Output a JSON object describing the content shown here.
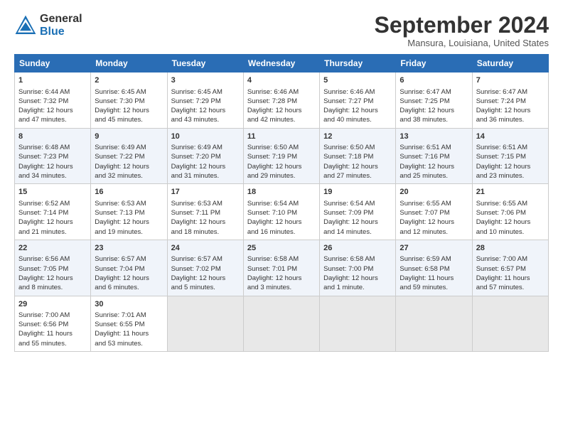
{
  "header": {
    "logo_general": "General",
    "logo_blue": "Blue",
    "month_title": "September 2024",
    "location": "Mansura, Louisiana, United States"
  },
  "days_of_week": [
    "Sunday",
    "Monday",
    "Tuesday",
    "Wednesday",
    "Thursday",
    "Friday",
    "Saturday"
  ],
  "weeks": [
    [
      {
        "day": "1",
        "lines": [
          "Sunrise: 6:44 AM",
          "Sunset: 7:32 PM",
          "Daylight: 12 hours",
          "and 47 minutes."
        ]
      },
      {
        "day": "2",
        "lines": [
          "Sunrise: 6:45 AM",
          "Sunset: 7:30 PM",
          "Daylight: 12 hours",
          "and 45 minutes."
        ]
      },
      {
        "day": "3",
        "lines": [
          "Sunrise: 6:45 AM",
          "Sunset: 7:29 PM",
          "Daylight: 12 hours",
          "and 43 minutes."
        ]
      },
      {
        "day": "4",
        "lines": [
          "Sunrise: 6:46 AM",
          "Sunset: 7:28 PM",
          "Daylight: 12 hours",
          "and 42 minutes."
        ]
      },
      {
        "day": "5",
        "lines": [
          "Sunrise: 6:46 AM",
          "Sunset: 7:27 PM",
          "Daylight: 12 hours",
          "and 40 minutes."
        ]
      },
      {
        "day": "6",
        "lines": [
          "Sunrise: 6:47 AM",
          "Sunset: 7:25 PM",
          "Daylight: 12 hours",
          "and 38 minutes."
        ]
      },
      {
        "day": "7",
        "lines": [
          "Sunrise: 6:47 AM",
          "Sunset: 7:24 PM",
          "Daylight: 12 hours",
          "and 36 minutes."
        ]
      }
    ],
    [
      {
        "day": "8",
        "lines": [
          "Sunrise: 6:48 AM",
          "Sunset: 7:23 PM",
          "Daylight: 12 hours",
          "and 34 minutes."
        ]
      },
      {
        "day": "9",
        "lines": [
          "Sunrise: 6:49 AM",
          "Sunset: 7:22 PM",
          "Daylight: 12 hours",
          "and 32 minutes."
        ]
      },
      {
        "day": "10",
        "lines": [
          "Sunrise: 6:49 AM",
          "Sunset: 7:20 PM",
          "Daylight: 12 hours",
          "and 31 minutes."
        ]
      },
      {
        "day": "11",
        "lines": [
          "Sunrise: 6:50 AM",
          "Sunset: 7:19 PM",
          "Daylight: 12 hours",
          "and 29 minutes."
        ]
      },
      {
        "day": "12",
        "lines": [
          "Sunrise: 6:50 AM",
          "Sunset: 7:18 PM",
          "Daylight: 12 hours",
          "and 27 minutes."
        ]
      },
      {
        "day": "13",
        "lines": [
          "Sunrise: 6:51 AM",
          "Sunset: 7:16 PM",
          "Daylight: 12 hours",
          "and 25 minutes."
        ]
      },
      {
        "day": "14",
        "lines": [
          "Sunrise: 6:51 AM",
          "Sunset: 7:15 PM",
          "Daylight: 12 hours",
          "and 23 minutes."
        ]
      }
    ],
    [
      {
        "day": "15",
        "lines": [
          "Sunrise: 6:52 AM",
          "Sunset: 7:14 PM",
          "Daylight: 12 hours",
          "and 21 minutes."
        ]
      },
      {
        "day": "16",
        "lines": [
          "Sunrise: 6:53 AM",
          "Sunset: 7:13 PM",
          "Daylight: 12 hours",
          "and 19 minutes."
        ]
      },
      {
        "day": "17",
        "lines": [
          "Sunrise: 6:53 AM",
          "Sunset: 7:11 PM",
          "Daylight: 12 hours",
          "and 18 minutes."
        ]
      },
      {
        "day": "18",
        "lines": [
          "Sunrise: 6:54 AM",
          "Sunset: 7:10 PM",
          "Daylight: 12 hours",
          "and 16 minutes."
        ]
      },
      {
        "day": "19",
        "lines": [
          "Sunrise: 6:54 AM",
          "Sunset: 7:09 PM",
          "Daylight: 12 hours",
          "and 14 minutes."
        ]
      },
      {
        "day": "20",
        "lines": [
          "Sunrise: 6:55 AM",
          "Sunset: 7:07 PM",
          "Daylight: 12 hours",
          "and 12 minutes."
        ]
      },
      {
        "day": "21",
        "lines": [
          "Sunrise: 6:55 AM",
          "Sunset: 7:06 PM",
          "Daylight: 12 hours",
          "and 10 minutes."
        ]
      }
    ],
    [
      {
        "day": "22",
        "lines": [
          "Sunrise: 6:56 AM",
          "Sunset: 7:05 PM",
          "Daylight: 12 hours",
          "and 8 minutes."
        ]
      },
      {
        "day": "23",
        "lines": [
          "Sunrise: 6:57 AM",
          "Sunset: 7:04 PM",
          "Daylight: 12 hours",
          "and 6 minutes."
        ]
      },
      {
        "day": "24",
        "lines": [
          "Sunrise: 6:57 AM",
          "Sunset: 7:02 PM",
          "Daylight: 12 hours",
          "and 5 minutes."
        ]
      },
      {
        "day": "25",
        "lines": [
          "Sunrise: 6:58 AM",
          "Sunset: 7:01 PM",
          "Daylight: 12 hours",
          "and 3 minutes."
        ]
      },
      {
        "day": "26",
        "lines": [
          "Sunrise: 6:58 AM",
          "Sunset: 7:00 PM",
          "Daylight: 12 hours",
          "and 1 minute."
        ]
      },
      {
        "day": "27",
        "lines": [
          "Sunrise: 6:59 AM",
          "Sunset: 6:58 PM",
          "Daylight: 11 hours",
          "and 59 minutes."
        ]
      },
      {
        "day": "28",
        "lines": [
          "Sunrise: 7:00 AM",
          "Sunset: 6:57 PM",
          "Daylight: 11 hours",
          "and 57 minutes."
        ]
      }
    ],
    [
      {
        "day": "29",
        "lines": [
          "Sunrise: 7:00 AM",
          "Sunset: 6:56 PM",
          "Daylight: 11 hours",
          "and 55 minutes."
        ]
      },
      {
        "day": "30",
        "lines": [
          "Sunrise: 7:01 AM",
          "Sunset: 6:55 PM",
          "Daylight: 11 hours",
          "and 53 minutes."
        ]
      },
      {
        "day": "",
        "lines": []
      },
      {
        "day": "",
        "lines": []
      },
      {
        "day": "",
        "lines": []
      },
      {
        "day": "",
        "lines": []
      },
      {
        "day": "",
        "lines": []
      }
    ]
  ]
}
